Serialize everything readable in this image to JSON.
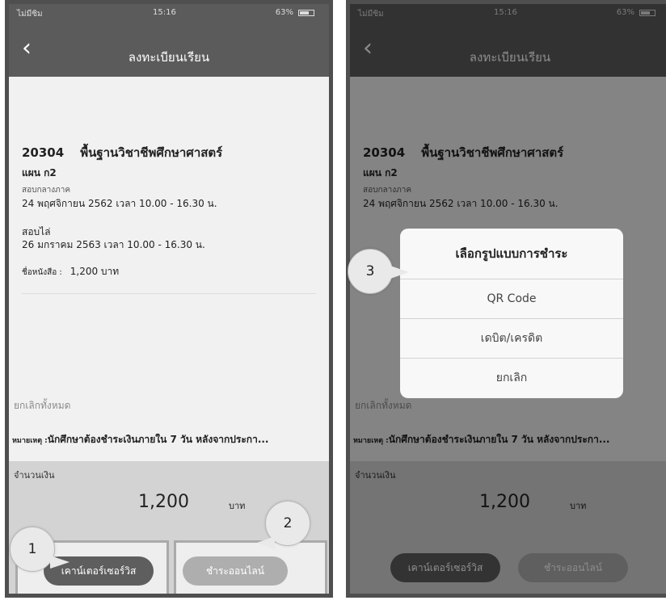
{
  "status": {
    "carrier": "ไม่มีซิม",
    "time": "15:16",
    "battery": "63%"
  },
  "nav": {
    "title": "ลงทะเบียนเรียน"
  },
  "course": {
    "code": "20304",
    "name": "พื้นฐานวิชาชีพศึกษาศาสตร์",
    "plan": "แผน ก2",
    "midterm_label": "สอบกลางภาค",
    "midterm_date": "24 พฤศจิกายน 2562 เวลา 10.00 - 16.30 น.",
    "final_label": "สอบไล่",
    "final_date": "26 มกราคม 2563 เวลา 10.00 - 16.30 น.",
    "book_label": "ชื่อหนังสือ :",
    "book_price": "1,200 บาท"
  },
  "cancel_all": "ยกเลิกทั้งหมด",
  "note": {
    "label": "หมายเหตุ :",
    "text": "นักศึกษาต้องชำระเงินภายใน 7 วัน หลังจากประกา..."
  },
  "amount": {
    "label": "จำนวนเงิน",
    "value": "1,200",
    "unit": "บาท"
  },
  "buttons": {
    "counter_service": "เคาน์เตอร์เซอร์วิส",
    "pay_online": "ชำระออนไลน์"
  },
  "dialog": {
    "title": "เลือกรูปแบบการชำระ",
    "options": [
      "QR Code",
      "เดบิต/เครดิต",
      "ยกเลิก"
    ]
  },
  "callouts": [
    "1",
    "2",
    "3"
  ],
  "colors": {
    "header": "#5b5b5b",
    "counter_button": "#5e5e5e",
    "online_button": "#aeaeae",
    "background": "#f1f1f1"
  }
}
